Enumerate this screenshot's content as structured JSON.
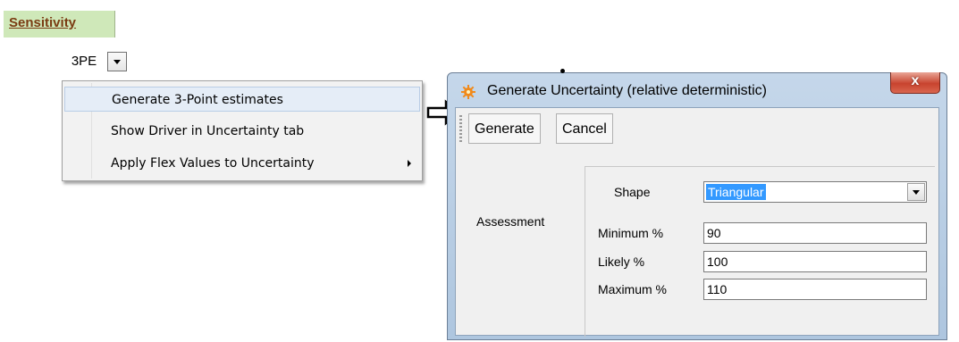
{
  "sensitivity_tab": {
    "label": "Sensitivity"
  },
  "dropdown": {
    "value": "3PE"
  },
  "menu": {
    "items": [
      {
        "label": "Generate 3-Point estimates",
        "selected": true
      },
      {
        "label": "Show Driver in Uncertainty tab",
        "selected": false
      },
      {
        "label": "Apply Flex Values to Uncertainty",
        "submenu": true
      }
    ]
  },
  "arrow": {
    "icon": "right-outline-arrow-icon"
  },
  "dialog": {
    "title": "Generate Uncertainty (relative deterministic)",
    "icon": "gear-icon",
    "close_label": "x",
    "toolbar": {
      "generate_label": "Generate",
      "cancel_label": "Cancel"
    },
    "assessment_label": "Assessment",
    "fields": {
      "shape_label": "Shape",
      "shape_value": "Triangular",
      "minimum_label": "Minimum %",
      "minimum_value": "90",
      "likely_label": "Likely %",
      "likely_value": "100",
      "maximum_label": "Maximum %",
      "maximum_value": "110"
    }
  },
  "colors": {
    "tab_bg": "#cfe8b9",
    "tab_text": "#7a3b12",
    "selection": "#3399ff",
    "close": "#c8432e"
  }
}
